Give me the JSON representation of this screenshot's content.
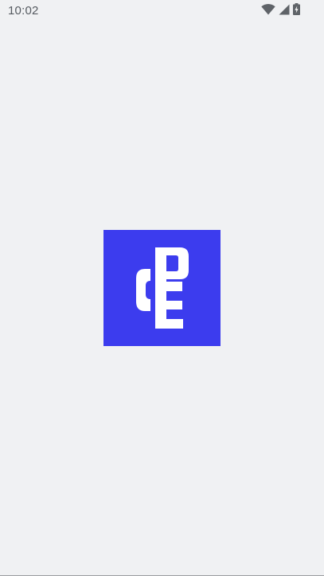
{
  "status_bar": {
    "time": "10:02",
    "icons": [
      "wifi-icon",
      "cellular-signal-icon",
      "battery-charging-icon"
    ]
  },
  "splash": {
    "logo": "app-logo",
    "logo_background": "#3c3cee",
    "logo_foreground": "#ffffff"
  },
  "colors": {
    "background": "#f0f1f3",
    "status_text": "#555a60"
  }
}
